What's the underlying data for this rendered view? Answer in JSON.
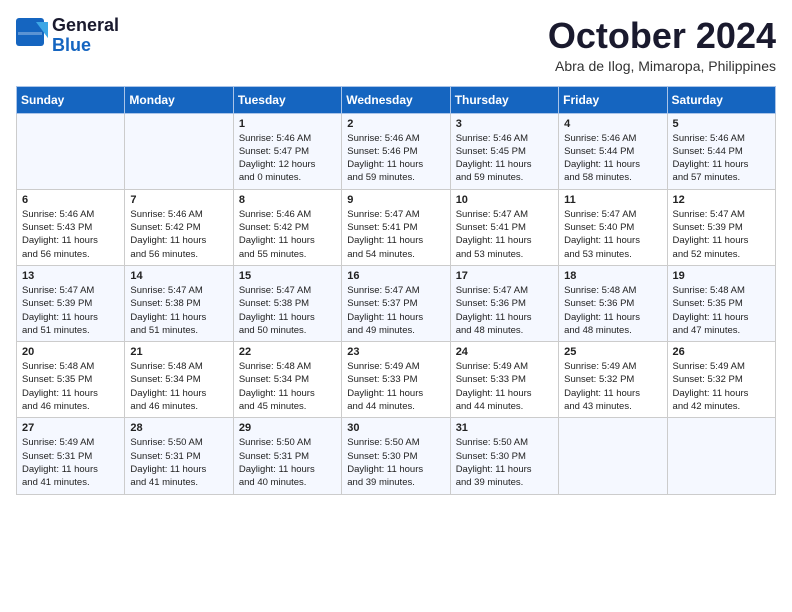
{
  "header": {
    "logo_line1": "General",
    "logo_line2": "Blue",
    "month": "October 2024",
    "location": "Abra de Ilog, Mimaropa, Philippines"
  },
  "weekdays": [
    "Sunday",
    "Monday",
    "Tuesday",
    "Wednesday",
    "Thursday",
    "Friday",
    "Saturday"
  ],
  "weeks": [
    [
      {
        "day": "",
        "info": ""
      },
      {
        "day": "",
        "info": ""
      },
      {
        "day": "1",
        "info": "Sunrise: 5:46 AM\nSunset: 5:47 PM\nDaylight: 12 hours\nand 0 minutes."
      },
      {
        "day": "2",
        "info": "Sunrise: 5:46 AM\nSunset: 5:46 PM\nDaylight: 11 hours\nand 59 minutes."
      },
      {
        "day": "3",
        "info": "Sunrise: 5:46 AM\nSunset: 5:45 PM\nDaylight: 11 hours\nand 59 minutes."
      },
      {
        "day": "4",
        "info": "Sunrise: 5:46 AM\nSunset: 5:44 PM\nDaylight: 11 hours\nand 58 minutes."
      },
      {
        "day": "5",
        "info": "Sunrise: 5:46 AM\nSunset: 5:44 PM\nDaylight: 11 hours\nand 57 minutes."
      }
    ],
    [
      {
        "day": "6",
        "info": "Sunrise: 5:46 AM\nSunset: 5:43 PM\nDaylight: 11 hours\nand 56 minutes."
      },
      {
        "day": "7",
        "info": "Sunrise: 5:46 AM\nSunset: 5:42 PM\nDaylight: 11 hours\nand 56 minutes."
      },
      {
        "day": "8",
        "info": "Sunrise: 5:46 AM\nSunset: 5:42 PM\nDaylight: 11 hours\nand 55 minutes."
      },
      {
        "day": "9",
        "info": "Sunrise: 5:47 AM\nSunset: 5:41 PM\nDaylight: 11 hours\nand 54 minutes."
      },
      {
        "day": "10",
        "info": "Sunrise: 5:47 AM\nSunset: 5:41 PM\nDaylight: 11 hours\nand 53 minutes."
      },
      {
        "day": "11",
        "info": "Sunrise: 5:47 AM\nSunset: 5:40 PM\nDaylight: 11 hours\nand 53 minutes."
      },
      {
        "day": "12",
        "info": "Sunrise: 5:47 AM\nSunset: 5:39 PM\nDaylight: 11 hours\nand 52 minutes."
      }
    ],
    [
      {
        "day": "13",
        "info": "Sunrise: 5:47 AM\nSunset: 5:39 PM\nDaylight: 11 hours\nand 51 minutes."
      },
      {
        "day": "14",
        "info": "Sunrise: 5:47 AM\nSunset: 5:38 PM\nDaylight: 11 hours\nand 51 minutes."
      },
      {
        "day": "15",
        "info": "Sunrise: 5:47 AM\nSunset: 5:38 PM\nDaylight: 11 hours\nand 50 minutes."
      },
      {
        "day": "16",
        "info": "Sunrise: 5:47 AM\nSunset: 5:37 PM\nDaylight: 11 hours\nand 49 minutes."
      },
      {
        "day": "17",
        "info": "Sunrise: 5:47 AM\nSunset: 5:36 PM\nDaylight: 11 hours\nand 48 minutes."
      },
      {
        "day": "18",
        "info": "Sunrise: 5:48 AM\nSunset: 5:36 PM\nDaylight: 11 hours\nand 48 minutes."
      },
      {
        "day": "19",
        "info": "Sunrise: 5:48 AM\nSunset: 5:35 PM\nDaylight: 11 hours\nand 47 minutes."
      }
    ],
    [
      {
        "day": "20",
        "info": "Sunrise: 5:48 AM\nSunset: 5:35 PM\nDaylight: 11 hours\nand 46 minutes."
      },
      {
        "day": "21",
        "info": "Sunrise: 5:48 AM\nSunset: 5:34 PM\nDaylight: 11 hours\nand 46 minutes."
      },
      {
        "day": "22",
        "info": "Sunrise: 5:48 AM\nSunset: 5:34 PM\nDaylight: 11 hours\nand 45 minutes."
      },
      {
        "day": "23",
        "info": "Sunrise: 5:49 AM\nSunset: 5:33 PM\nDaylight: 11 hours\nand 44 minutes."
      },
      {
        "day": "24",
        "info": "Sunrise: 5:49 AM\nSunset: 5:33 PM\nDaylight: 11 hours\nand 44 minutes."
      },
      {
        "day": "25",
        "info": "Sunrise: 5:49 AM\nSunset: 5:32 PM\nDaylight: 11 hours\nand 43 minutes."
      },
      {
        "day": "26",
        "info": "Sunrise: 5:49 AM\nSunset: 5:32 PM\nDaylight: 11 hours\nand 42 minutes."
      }
    ],
    [
      {
        "day": "27",
        "info": "Sunrise: 5:49 AM\nSunset: 5:31 PM\nDaylight: 11 hours\nand 41 minutes."
      },
      {
        "day": "28",
        "info": "Sunrise: 5:50 AM\nSunset: 5:31 PM\nDaylight: 11 hours\nand 41 minutes."
      },
      {
        "day": "29",
        "info": "Sunrise: 5:50 AM\nSunset: 5:31 PM\nDaylight: 11 hours\nand 40 minutes."
      },
      {
        "day": "30",
        "info": "Sunrise: 5:50 AM\nSunset: 5:30 PM\nDaylight: 11 hours\nand 39 minutes."
      },
      {
        "day": "31",
        "info": "Sunrise: 5:50 AM\nSunset: 5:30 PM\nDaylight: 11 hours\nand 39 minutes."
      },
      {
        "day": "",
        "info": ""
      },
      {
        "day": "",
        "info": ""
      }
    ]
  ]
}
